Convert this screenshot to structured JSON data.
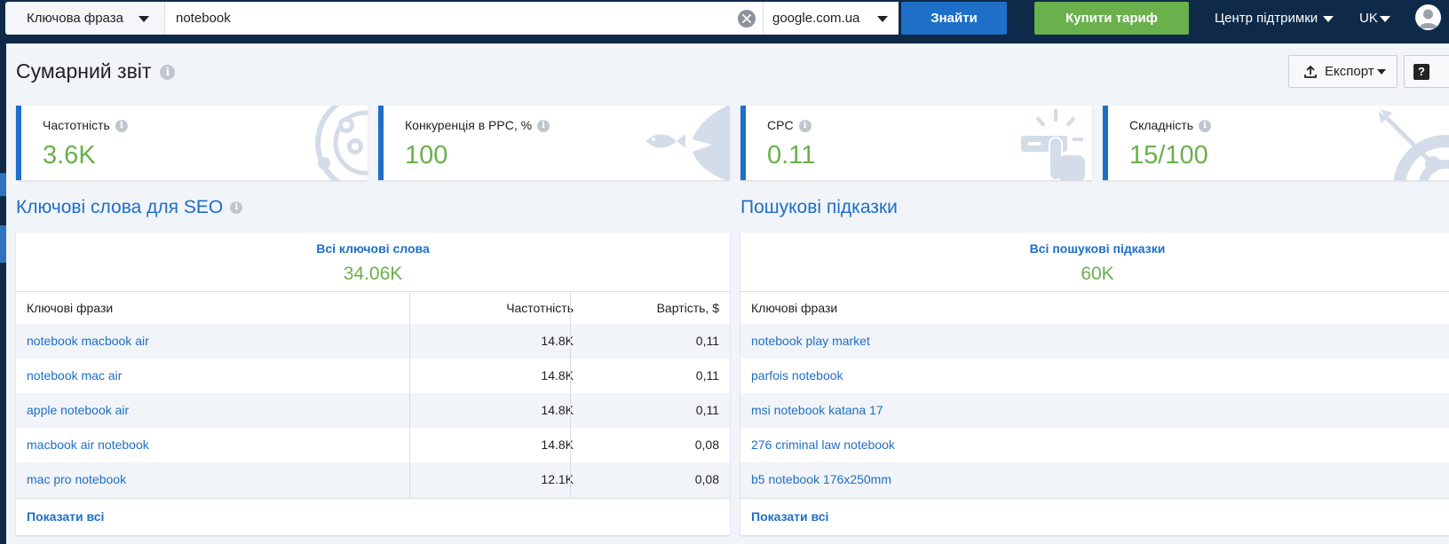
{
  "topbar": {
    "search_type": "Ключова фраза",
    "query": "notebook",
    "database": "google.com.ua",
    "find_label": "Знайти",
    "buy_label": "Купити тариф",
    "support_label": "Центр підтримки",
    "language": "UK"
  },
  "page": {
    "title": "Сумарний звіт",
    "export_label": "Експорт",
    "help_label": "?"
  },
  "metrics": [
    {
      "label": "Частотність",
      "value": "3.6K",
      "icon": "orbit-icon"
    },
    {
      "label": "Конкуренція в PPC, %",
      "value": "100",
      "icon": "fish-icon"
    },
    {
      "label": "CPC",
      "value": "0.11",
      "icon": "click-icon"
    },
    {
      "label": "Складність",
      "value": "15/100",
      "icon": "target-icon"
    }
  ],
  "seo": {
    "title": "Ключові слова для SEO",
    "summary_label": "Всі ключові слова",
    "summary_value": "34.06K",
    "columns": [
      "Ключові фрази",
      "Частотність",
      "Вартість, $"
    ],
    "rows": [
      {
        "keyword": "notebook macbook air",
        "volume": "14.8K",
        "cost": "0,11"
      },
      {
        "keyword": "notebook mac air",
        "volume": "14.8K",
        "cost": "0,11"
      },
      {
        "keyword": "apple notebook air",
        "volume": "14.8K",
        "cost": "0,11"
      },
      {
        "keyword": "macbook air notebook",
        "volume": "14.8K",
        "cost": "0,08"
      },
      {
        "keyword": "mac pro notebook",
        "volume": "12.1K",
        "cost": "0,08"
      }
    ],
    "show_all": "Показати всі"
  },
  "suggestions": {
    "title": "Пошукові підказки",
    "summary_label": "Всі пошукові підказки",
    "summary_value": "60K",
    "columns": [
      "Ключові фрази"
    ],
    "rows": [
      {
        "keyword": "notebook play market"
      },
      {
        "keyword": "parfois notebook"
      },
      {
        "keyword": "msi notebook katana 17"
      },
      {
        "keyword": "276 criminal law notebook"
      },
      {
        "keyword": "b5 notebook 176x250mm"
      }
    ],
    "show_all": "Показати всі"
  },
  "colors": {
    "navy": "#0f2a49",
    "accent_blue": "#1e6fc7",
    "green": "#6ab04c",
    "page_bg": "#f1f4f9"
  }
}
